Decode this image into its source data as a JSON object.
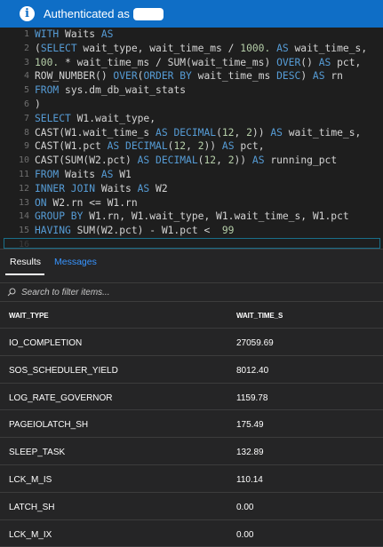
{
  "banner": {
    "text": "Authenticated as",
    "icon": "info-icon"
  },
  "editor": {
    "lines": [
      {
        "n": "1",
        "tokens": [
          [
            "kw",
            "WITH"
          ],
          [
            "",
            " Waits "
          ],
          [
            "kw",
            "AS"
          ]
        ]
      },
      {
        "n": "2",
        "tokens": [
          [
            "",
            "("
          ],
          [
            "kw",
            "SELECT"
          ],
          [
            "",
            " wait_type, wait_time_ms / "
          ],
          [
            "num",
            "1000."
          ],
          [
            "",
            " "
          ],
          [
            "kw",
            "AS"
          ],
          [
            "",
            " wait_time_s,"
          ]
        ]
      },
      {
        "n": "3",
        "tokens": [
          [
            "num",
            "100."
          ],
          [
            "",
            " * wait_time_ms / SUM(wait_time_ms) "
          ],
          [
            "kw",
            "OVER"
          ],
          [
            "",
            "() "
          ],
          [
            "kw",
            "AS"
          ],
          [
            "",
            " pct,"
          ]
        ]
      },
      {
        "n": "4",
        "tokens": [
          [
            "",
            "ROW_NUMBER() "
          ],
          [
            "kw",
            "OVER"
          ],
          [
            "",
            "("
          ],
          [
            "kw",
            "ORDER BY"
          ],
          [
            "",
            " wait_time_ms "
          ],
          [
            "kw",
            "DESC"
          ],
          [
            "",
            ") "
          ],
          [
            "kw",
            "AS"
          ],
          [
            "",
            " rn"
          ]
        ]
      },
      {
        "n": "5",
        "tokens": [
          [
            "kw",
            "FROM"
          ],
          [
            "",
            " sys.dm_db_wait_stats"
          ]
        ]
      },
      {
        "n": "6",
        "tokens": [
          [
            "",
            ")"
          ]
        ]
      },
      {
        "n": "7",
        "tokens": [
          [
            "kw",
            "SELECT"
          ],
          [
            "",
            " W1.wait_type,"
          ]
        ]
      },
      {
        "n": "8",
        "tokens": [
          [
            "",
            "CAST(W1.wait_time_s "
          ],
          [
            "kw",
            "AS"
          ],
          [
            "",
            " "
          ],
          [
            "kw",
            "DECIMAL"
          ],
          [
            "",
            "("
          ],
          [
            "num",
            "12"
          ],
          [
            "",
            ", "
          ],
          [
            "num",
            "2"
          ],
          [
            "",
            ")) "
          ],
          [
            "kw",
            "AS"
          ],
          [
            "",
            " wait_time_s,"
          ]
        ]
      },
      {
        "n": "9",
        "tokens": [
          [
            "",
            "CAST(W1.pct "
          ],
          [
            "kw",
            "AS"
          ],
          [
            "",
            " "
          ],
          [
            "kw",
            "DECIMAL"
          ],
          [
            "",
            "("
          ],
          [
            "num",
            "12"
          ],
          [
            "",
            ", "
          ],
          [
            "num",
            "2"
          ],
          [
            "",
            ")) "
          ],
          [
            "kw",
            "AS"
          ],
          [
            "",
            " pct,"
          ]
        ]
      },
      {
        "n": "10",
        "tokens": [
          [
            "",
            "CAST(SUM(W2.pct) "
          ],
          [
            "kw",
            "AS"
          ],
          [
            "",
            " "
          ],
          [
            "kw",
            "DECIMAL"
          ],
          [
            "",
            "("
          ],
          [
            "num",
            "12"
          ],
          [
            "",
            ", "
          ],
          [
            "num",
            "2"
          ],
          [
            "",
            ")) "
          ],
          [
            "kw",
            "AS"
          ],
          [
            "",
            " running_pct"
          ]
        ]
      },
      {
        "n": "11",
        "tokens": [
          [
            "kw",
            "FROM"
          ],
          [
            "",
            " Waits "
          ],
          [
            "kw",
            "AS"
          ],
          [
            "",
            " W1"
          ]
        ]
      },
      {
        "n": "12",
        "tokens": [
          [
            "kw",
            "INNER JOIN"
          ],
          [
            "",
            " Waits "
          ],
          [
            "kw",
            "AS"
          ],
          [
            "",
            " W2"
          ]
        ]
      },
      {
        "n": "13",
        "tokens": [
          [
            "kw",
            "ON"
          ],
          [
            "",
            " W2.rn <= W1.rn"
          ]
        ]
      },
      {
        "n": "14",
        "tokens": [
          [
            "kw",
            "GROUP BY"
          ],
          [
            "",
            " W1.rn, W1.wait_type, W1.wait_time_s, W1.pct"
          ]
        ]
      },
      {
        "n": "15",
        "tokens": [
          [
            "kw",
            "HAVING"
          ],
          [
            "",
            " SUM(W2.pct) - W1.pct <  "
          ],
          [
            "num",
            "99"
          ]
        ]
      },
      {
        "n": "16",
        "tokens": []
      }
    ]
  },
  "tabs": {
    "results": "Results",
    "messages": "Messages"
  },
  "filter": {
    "placeholder": "Search to filter items..."
  },
  "table": {
    "headers": [
      "WAIT_TYPE",
      "WAIT_TIME_S"
    ],
    "rows": [
      [
        "IO_COMPLETION",
        "27059.69"
      ],
      [
        "SOS_SCHEDULER_YIELD",
        "8012.40"
      ],
      [
        "LOG_RATE_GOVERNOR",
        "1159.78"
      ],
      [
        "PAGEIOLATCH_SH",
        "175.49"
      ],
      [
        "SLEEP_TASK",
        "132.89"
      ],
      [
        "LCK_M_IS",
        "110.14"
      ],
      [
        "LATCH_SH",
        "0.00"
      ],
      [
        "LCK_M_IX",
        "0.00"
      ]
    ]
  },
  "colors": {
    "accent": "#0f6ec6",
    "keyword": "#569cd6",
    "number": "#b5cea8",
    "link": "#3794ff"
  }
}
